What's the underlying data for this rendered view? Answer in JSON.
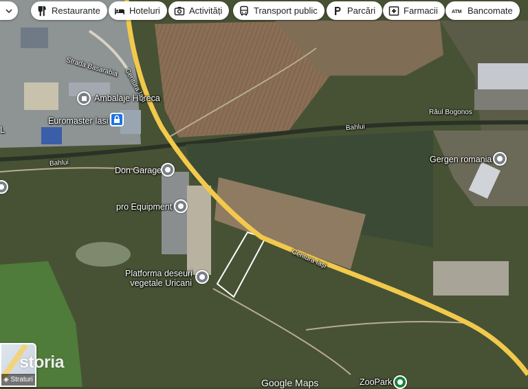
{
  "filters": [
    {
      "label": "Restaurante",
      "icon": "fork-knife-icon"
    },
    {
      "label": "Hoteluri",
      "icon": "bed-icon"
    },
    {
      "label": "Activități",
      "icon": "camera-icon"
    },
    {
      "label": "Transport public",
      "icon": "bus-icon"
    },
    {
      "label": "Parcări",
      "icon": "parking-icon"
    },
    {
      "label": "Farmacii",
      "icon": "pharmacy-icon"
    },
    {
      "label": "Bancomate",
      "icon": "atm-icon"
    }
  ],
  "places": {
    "ambalaje": "Ambalaje Horeca",
    "euromaster": "Euromaster Iasi",
    "don_garage": "Don Garage",
    "pro_equipment": "pro Equipment",
    "platforma_line1": "Platforma deseuri",
    "platforma_line2": "vegetale Uricani",
    "gergen": "Gergen romania",
    "zoopark": "ZooPark"
  },
  "roads": {
    "basarabia": "Strada Basarabia",
    "centura_upper": "Centura Iași",
    "centura_lower": "Centura Iași",
    "bahlui_left": "Bahlui",
    "bahlui_right": "Bahlui",
    "raul_bogonos": "Râul Bogonos"
  },
  "edge_labels": {
    "left_letter": "L"
  },
  "layers_label": "Straturi",
  "watermark": "storia",
  "attribution": "Google Maps",
  "colors": {
    "road": "#f2c94c",
    "pin": "#7a7f86",
    "parking_pin": "#1a73e8",
    "zoopark_pin": "#188038"
  }
}
